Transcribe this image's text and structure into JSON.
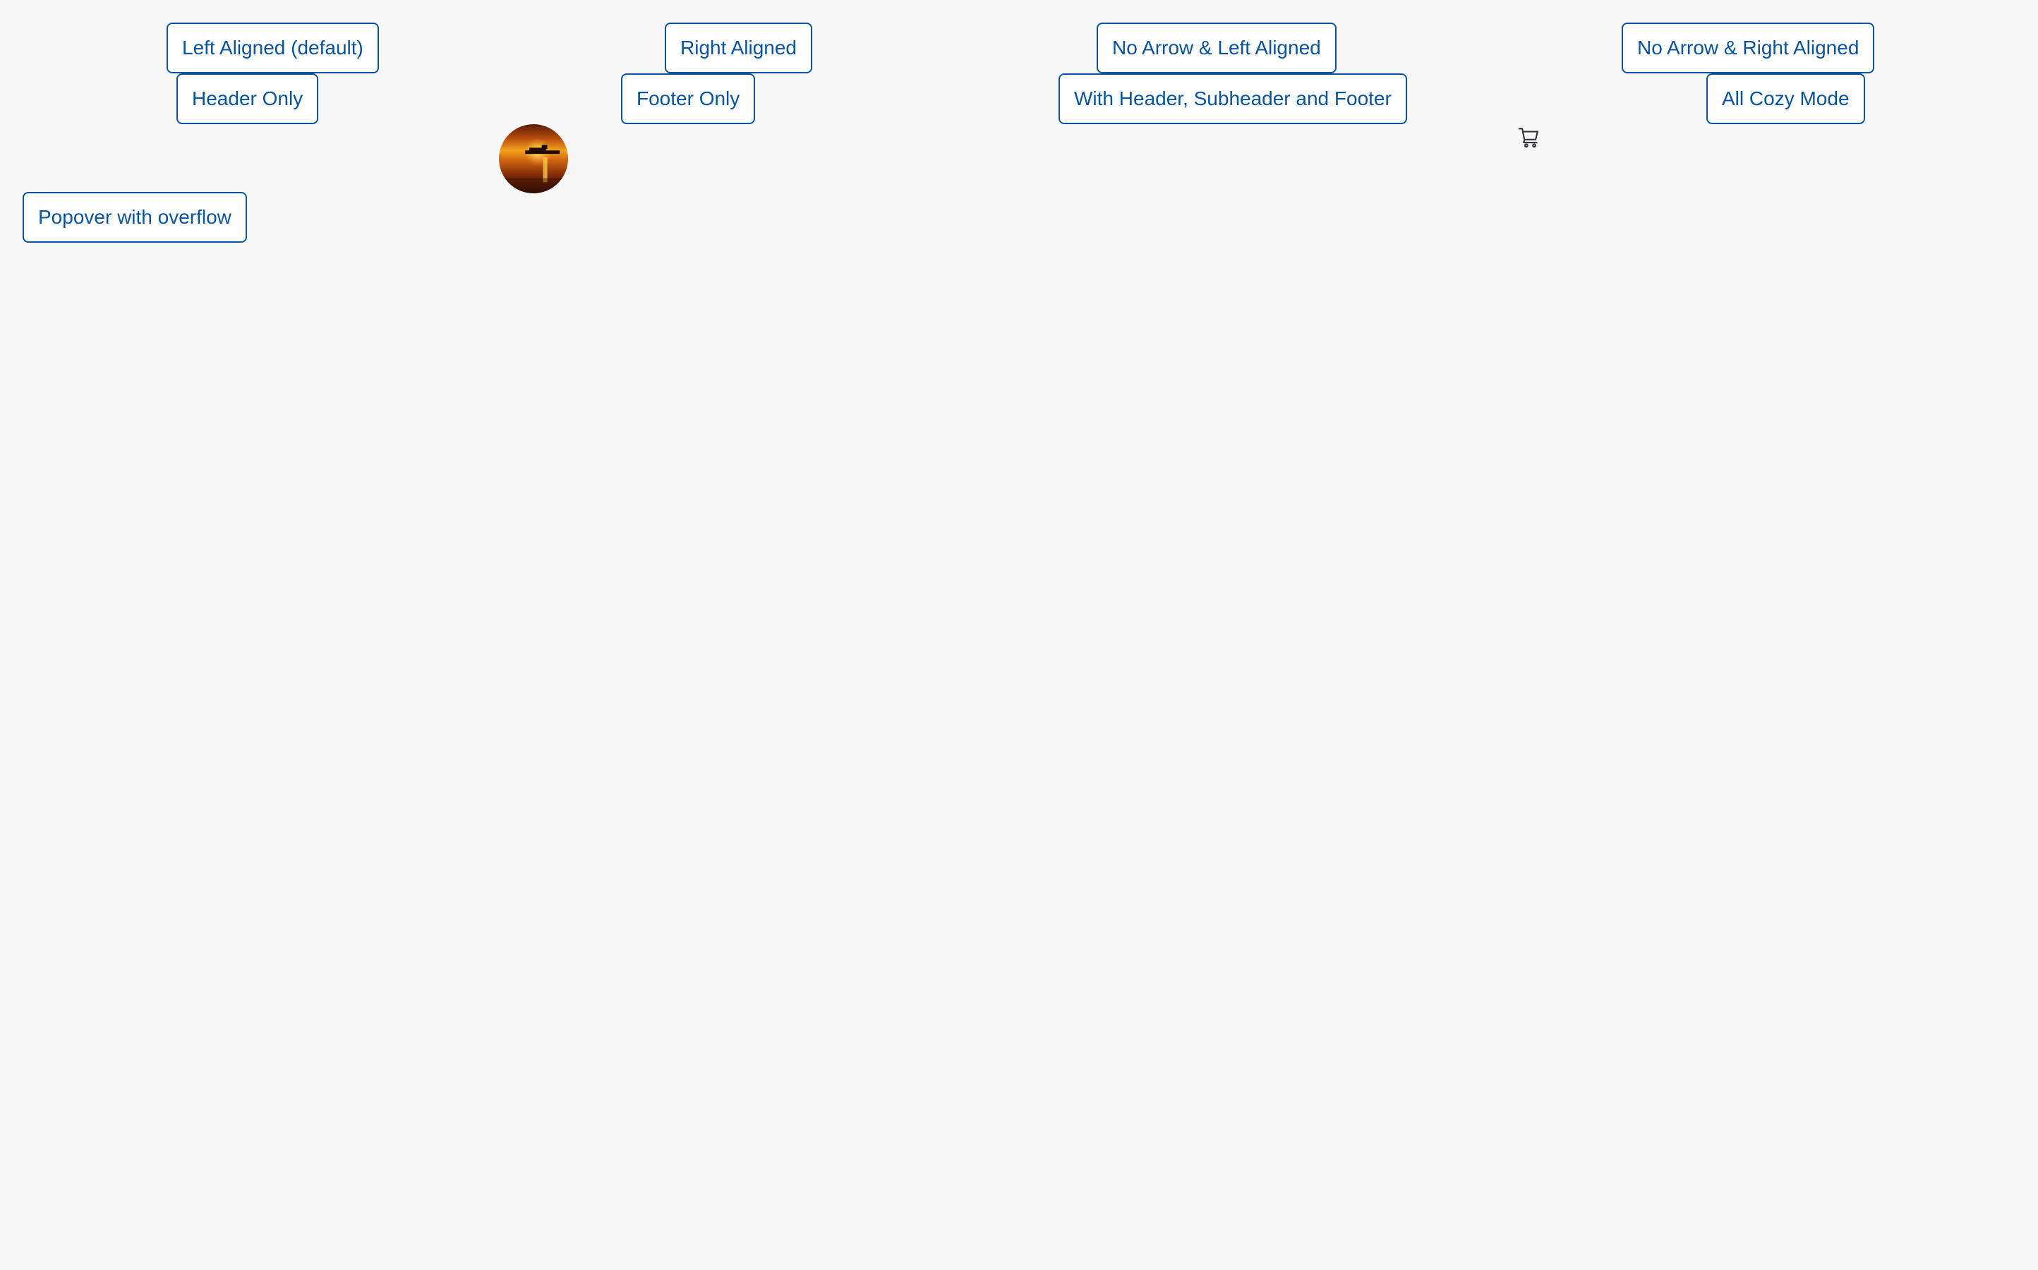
{
  "buttons": {
    "left_aligned_default": "Left Aligned (default)",
    "right_aligned": "Right Aligned",
    "no_arrow_left_aligned": "No Arrow & Left Aligned",
    "no_arrow_right_aligned": "No Arrow & Right Aligned",
    "header_only": "Header Only",
    "footer_only": "Footer Only",
    "with_header_subheader_footer": "With Header, Subheader and Footer",
    "all_cozy_mode": "All Cozy Mode",
    "popover_with_overflow": "Popover with overflow"
  },
  "icons": {
    "avatar": "sunset-avatar",
    "cart": "cart-icon"
  },
  "colors": {
    "background": "#f7f7f7",
    "button_text": "#0854a0",
    "button_border": "#0854a0",
    "button_background": "#ffffff"
  }
}
